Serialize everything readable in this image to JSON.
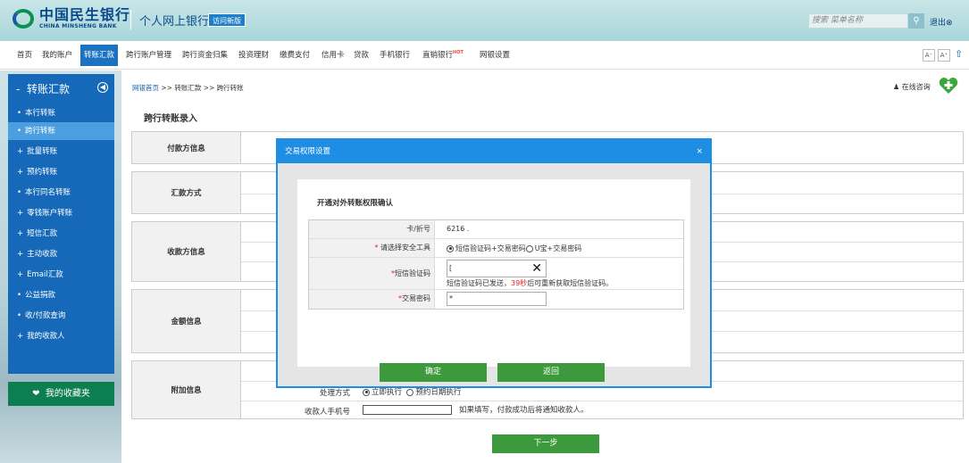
{
  "header": {
    "bank_name": "中国民生银行",
    "bank_name_en": "CHINA MINSHENG BANK",
    "app_title": "个人网上银行",
    "old_version_link": "访问新版",
    "search_placeholder": "搜索 菜单名称",
    "logout": "退出⊗"
  },
  "nav": {
    "items": [
      "首页",
      "我的账户",
      "转账汇款",
      "跨行账户管理",
      "跨行资金归集",
      "投资理财",
      "缴费支付",
      "信用卡",
      "贷款",
      "手机银行",
      "直销银行",
      "网银设置"
    ],
    "hot_badge": "HOT",
    "font_small": "A⁻",
    "font_large": "A⁺"
  },
  "sidebar": {
    "title": "转账汇款",
    "items": [
      "本行转账",
      "跨行转账",
      "批量转账",
      "预约转账",
      "本行同名转账",
      "零钱账户转账",
      "短信汇款",
      "主动收款",
      "Email汇款",
      "公益捐款",
      "收/付款查询",
      "我的收款人"
    ],
    "favorites": "我的收藏夹"
  },
  "main": {
    "breadcrumb": {
      "home": "网银首页",
      "level1": "转账汇款",
      "level2": "跨行转账"
    },
    "online_consult": "在线咨询",
    "page_title": "跨行转账录入",
    "sections": [
      "付款方信息",
      "汇款方式",
      "收款方信息",
      "金额信息",
      "附加信息"
    ],
    "process_mode_label": "处理方式",
    "process_mode_now": "立即执行",
    "process_mode_scheduled": "预约日期执行",
    "payee_phone_label": "收款人手机号",
    "payee_phone_hint": "如果填写，付款成功后将通知收款人。",
    "next_button": "下一步"
  },
  "modal": {
    "title": "交易权限设置",
    "close": "×",
    "subtitle": "开通对外转账权限确认",
    "card_label": "卡/折号",
    "card_value": "6216 .",
    "tool_label": "请选择安全工具",
    "tool_option_sms": "短信验证码+交易密码",
    "tool_option_ukey": "U宝+交易密码",
    "sms_label": "短信验证码",
    "sms_value": "[",
    "sms_hint_prefix": "短信验证码已发送，",
    "sms_countdown": "39秒",
    "sms_hint_suffix": "后可重新获取短信验证码。",
    "pwd_label": "交易密码",
    "pwd_value": "*",
    "confirm_button": "确定",
    "back_button": "返回"
  }
}
